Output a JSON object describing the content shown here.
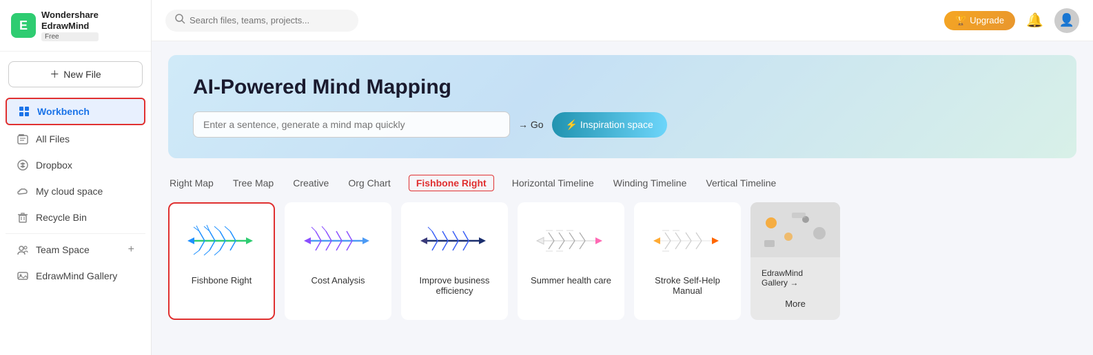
{
  "app": {
    "name": "Wondershare\nEdrawMind",
    "badge": "Free",
    "logo_letter": "E"
  },
  "sidebar": {
    "new_file_label": "New File",
    "nav_items": [
      {
        "id": "workbench",
        "label": "Workbench",
        "icon": "workbench",
        "active": true
      },
      {
        "id": "all-files",
        "label": "All Files",
        "icon": "files"
      },
      {
        "id": "dropbox",
        "label": "Dropbox",
        "icon": "cloud"
      },
      {
        "id": "my-cloud",
        "label": "My cloud space",
        "icon": "cloud2"
      },
      {
        "id": "recycle",
        "label": "Recycle Bin",
        "icon": "trash"
      },
      {
        "id": "team-space",
        "label": "Team Space",
        "icon": "team"
      },
      {
        "id": "gallery",
        "label": "EdrawMind Gallery",
        "icon": "gallery"
      }
    ]
  },
  "topbar": {
    "search_placeholder": "Search files, teams, projects...",
    "upgrade_label": "Upgrade",
    "upgrade_icon": "🏆"
  },
  "hero": {
    "title": "AI-Powered Mind Mapping",
    "input_placeholder": "Enter a sentence, generate a mind map quickly",
    "go_label": "→ Go",
    "inspiration_label": "⚡ Inspiration space"
  },
  "tabs": [
    {
      "id": "right-map",
      "label": "Right Map",
      "active": false
    },
    {
      "id": "tree-map",
      "label": "Tree Map",
      "active": false
    },
    {
      "id": "creative",
      "label": "Creative",
      "active": false
    },
    {
      "id": "org-chart",
      "label": "Org Chart",
      "active": false
    },
    {
      "id": "fishbone-right",
      "label": "Fishbone Right",
      "active": true
    },
    {
      "id": "horizontal-timeline",
      "label": "Horizontal Timeline",
      "active": false
    },
    {
      "id": "winding-timeline",
      "label": "Winding Timeline",
      "active": false
    },
    {
      "id": "vertical-timeline",
      "label": "Vertical Timeline",
      "active": false
    }
  ],
  "templates": [
    {
      "id": "fishbone-right",
      "label": "Fishbone Right",
      "selected": true
    },
    {
      "id": "cost-analysis",
      "label": "Cost Analysis",
      "selected": false
    },
    {
      "id": "business-efficiency",
      "label": "Improve business efficiency",
      "selected": false
    },
    {
      "id": "summer-health",
      "label": "Summer health care",
      "selected": false
    },
    {
      "id": "stroke-manual",
      "label": "Stroke Self-Help Manual",
      "selected": false
    }
  ],
  "gallery": {
    "label": "EdrawMind Gallery →",
    "more": "More"
  }
}
